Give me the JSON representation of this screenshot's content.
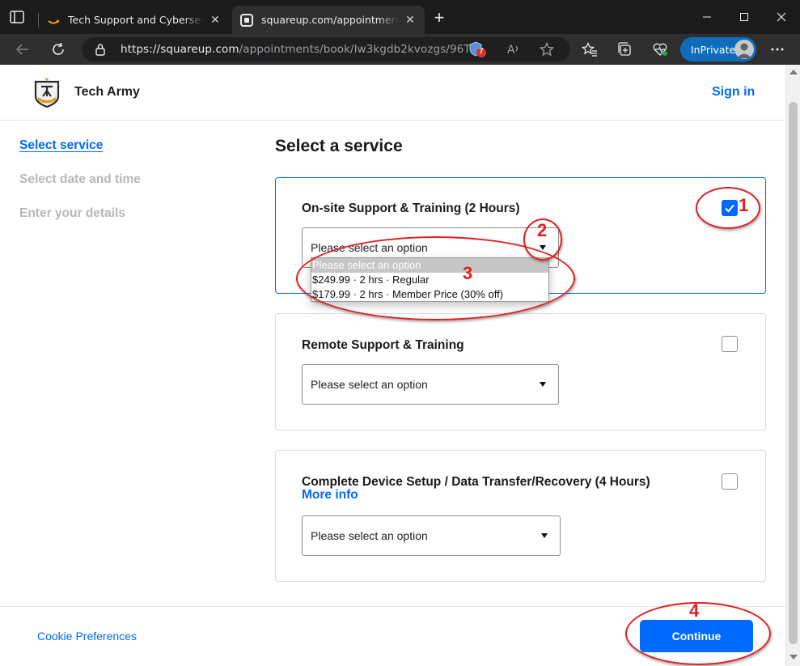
{
  "browser": {
    "tabs": [
      {
        "title": "Tech Support and Cybersecurity -",
        "active": false
      },
      {
        "title": "squareup.com/appointments/bo",
        "active": true
      }
    ],
    "address_host": "https://squareup.com",
    "address_path": "/appointments/book/lw3kgdb2kvozgs/96T...",
    "badge_count": "7",
    "inprivate_label": "InPrivate"
  },
  "header": {
    "business_name": "Tech Army",
    "sign_in": "Sign in"
  },
  "steps": [
    {
      "label": "Select service",
      "active": true
    },
    {
      "label": "Select date and time",
      "active": false
    },
    {
      "label": "Enter your details",
      "active": false
    }
  ],
  "main": {
    "heading": "Select a service",
    "services": [
      {
        "name": "On-site Support & Training (2 Hours)",
        "checked": true,
        "select_value": "Please select an option"
      },
      {
        "name": "Remote Support & Training",
        "checked": false,
        "select_value": "Please select an option"
      },
      {
        "name": "Complete Device Setup / Data Transfer/Recovery (4 Hours)",
        "more_info": "More info",
        "checked": false,
        "select_value": "Please select an option"
      }
    ],
    "dropdown_options": [
      "Please select an option",
      "$249.99 · 2 hrs · Regular",
      "$179.99 · 2 hrs · Member Price (30% off)"
    ]
  },
  "footer": {
    "cookie_preferences": "Cookie Preferences",
    "continue": "Continue"
  },
  "annotations": [
    "1",
    "2",
    "3",
    "4"
  ],
  "colors": {
    "accent": "#006aff",
    "annotation": "#e02020",
    "chrome_dark": "#202124",
    "inprivate": "#0f6cbd"
  }
}
